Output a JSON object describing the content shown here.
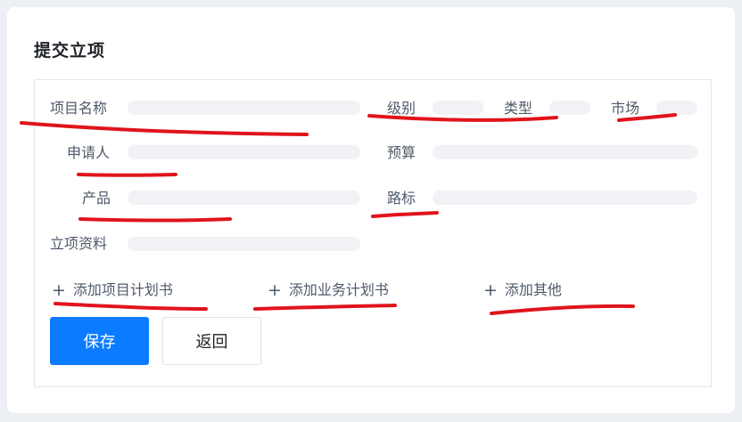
{
  "card": {
    "title": "提交立项"
  },
  "form": {
    "labels": {
      "project_name": "项目名称",
      "level": "级别",
      "type": "类型",
      "market": "市场",
      "applicant": "申请人",
      "budget": "预算",
      "product": "产品",
      "roadmap": "路标",
      "materials": "立项资料"
    },
    "add_links": {
      "project_plan": "添加项目计划书",
      "business_plan": "添加业务计划书",
      "other": "添加其他"
    }
  },
  "buttons": {
    "save": "保存",
    "back": "返回"
  },
  "colors": {
    "accent": "#0b7cff",
    "annotation": "#e0141b",
    "field_placeholder": "#f0f2f5"
  },
  "icons": {
    "add": "plus-icon"
  }
}
